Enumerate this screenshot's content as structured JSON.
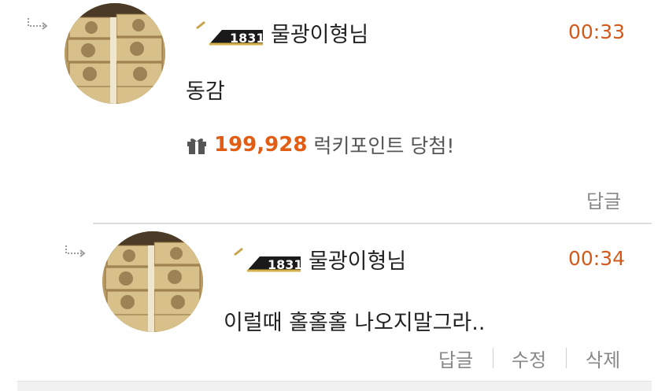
{
  "colors": {
    "accent": "#d25a1a",
    "text": "#222222",
    "muted": "#888888"
  },
  "comments": [
    {
      "nickname": "물광이형님",
      "badge_text": "1831",
      "time": "00:33",
      "text": "동감",
      "lucky_points": "199,928",
      "lucky_label": "럭키포인트 당첨!",
      "actions": [
        "답글"
      ]
    },
    {
      "nickname": "물광이형님",
      "badge_text": "1831",
      "time": "00:34",
      "text": "이럴때 홀홀홀 나오지말그라..",
      "actions": [
        "답글",
        "수정",
        "삭제"
      ]
    }
  ]
}
